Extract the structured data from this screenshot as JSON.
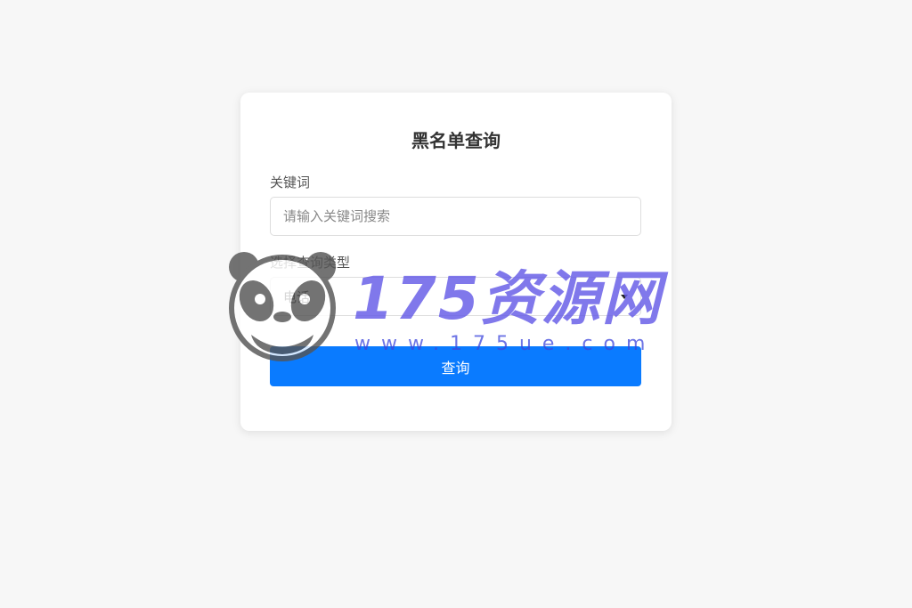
{
  "form": {
    "title": "黑名单查询",
    "keyword_label": "关键词",
    "keyword_placeholder": "请输入关键词搜索",
    "keyword_value": "",
    "type_label": "选择查询类型",
    "type_selected": "电话",
    "submit_label": "查询"
  },
  "watermark": {
    "brand": "175资源网",
    "url": "www.175ue.com"
  },
  "colors": {
    "background": "#f7f7f7",
    "card": "#ffffff",
    "primary_button": "#0a7bff",
    "watermark": "#645ae6"
  },
  "icons": {
    "select_arrow": "chevron-down-icon",
    "watermark_logo": "panda-logo-icon"
  }
}
